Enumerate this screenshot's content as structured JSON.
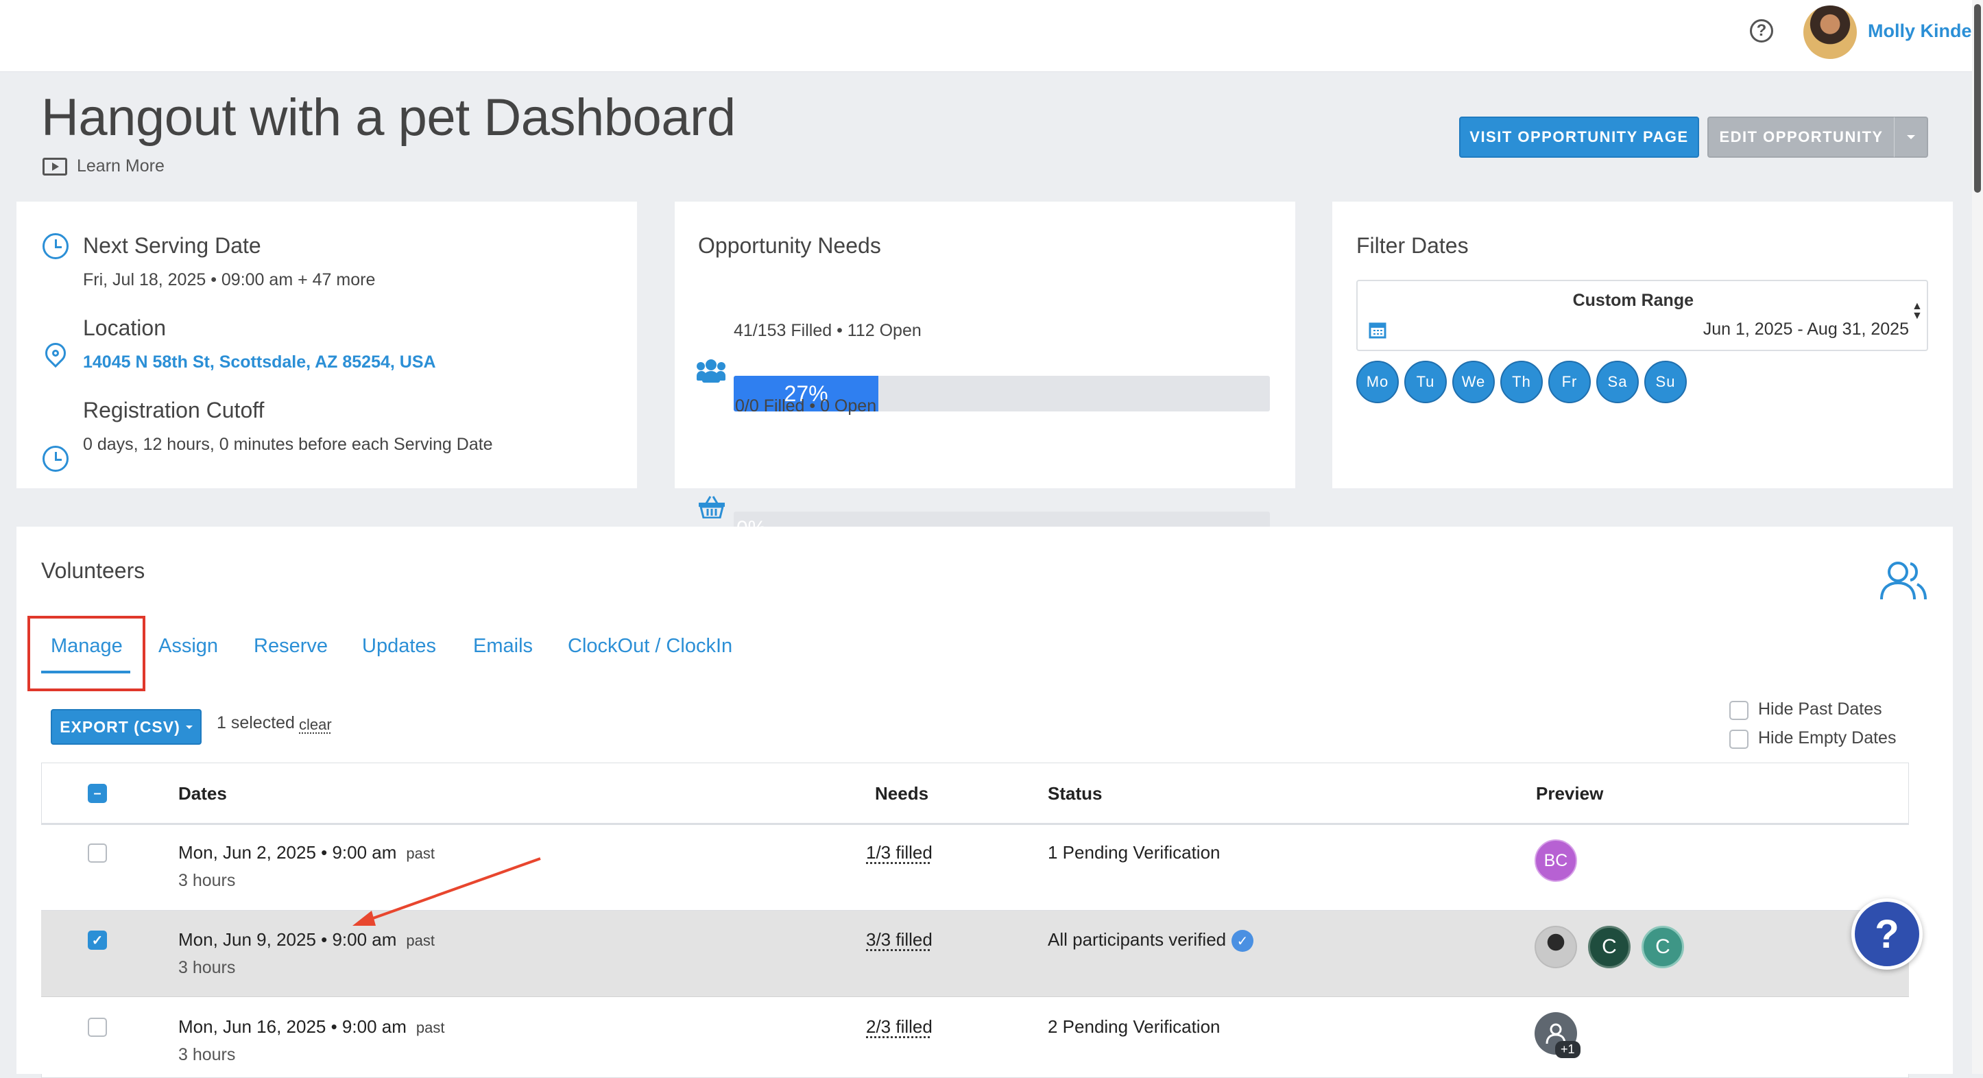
{
  "header": {
    "user_name": "Molly Kinder"
  },
  "page": {
    "title": "Hangout with a pet Dashboard",
    "learn_more": "Learn More"
  },
  "actions": {
    "visit_label": "VISIT OPPORTUNITY PAGE",
    "edit_label": "EDIT OPPORTUNITY"
  },
  "info": {
    "next_title": "Next Serving Date",
    "next_value": "Fri, Jul 18, 2025 • 09:00 am + 47 more",
    "location_title": "Location",
    "location_value": "14045 N 58th St, Scottsdale, AZ 85254, USA",
    "cutoff_title": "Registration Cutoff",
    "cutoff_value": "0 days, 12 hours, 0 minutes before each Serving Date"
  },
  "needs": {
    "title": "Opportunity Needs",
    "people": {
      "percent_label": "27%",
      "fraction": 0.27,
      "caption": "41/153 Filled • 112 Open"
    },
    "items": {
      "percent_label": "0%",
      "fraction": 0,
      "caption": "0/0 Filled • 0 Open"
    }
  },
  "filter": {
    "title": "Filter Dates",
    "range_label": "Custom Range",
    "range_value": "Jun 1, 2025 - Aug 31, 2025",
    "days": [
      "Mo",
      "Tu",
      "We",
      "Th",
      "Fr",
      "Sa",
      "Su"
    ]
  },
  "volunteers": {
    "title": "Volunteers",
    "tabs": [
      "Manage",
      "Assign",
      "Reserve",
      "Updates",
      "Emails",
      "ClockOut / ClockIn"
    ],
    "active_tab": "Manage",
    "export_label": "EXPORT (CSV)",
    "selected_text": "1 selected",
    "clear_label": "clear",
    "hide_past": "Hide Past Dates",
    "hide_empty": "Hide Empty Dates",
    "columns": {
      "dates": "Dates",
      "needs": "Needs",
      "status": "Status",
      "preview": "Preview"
    },
    "rows": [
      {
        "date": "Mon, Jun 2, 2025 • 9:00 am",
        "tag": "past",
        "duration": "3 hours",
        "needs": "1/3 filled",
        "status": "1 Pending Verification",
        "checked": false,
        "preview": [
          "BC"
        ]
      },
      {
        "date": "Mon, Jun 9, 2025 • 9:00 am",
        "tag": "past",
        "duration": "3 hours",
        "needs": "3/3 filled",
        "status": "All participants verified",
        "checked": true,
        "preview": [
          "photo",
          "C",
          "C"
        ]
      },
      {
        "date": "Mon, Jun 16, 2025 • 9:00 am",
        "tag": "past",
        "duration": "3 hours",
        "needs": "2/3 filled",
        "status": "2 Pending Verification",
        "checked": false,
        "preview": [
          "+1"
        ]
      }
    ]
  },
  "help_widget": {
    "label": "?"
  },
  "colors": {
    "accent": "#2b8fd6",
    "highlight": "#e3e3e3",
    "annotation": "#e8462e"
  }
}
